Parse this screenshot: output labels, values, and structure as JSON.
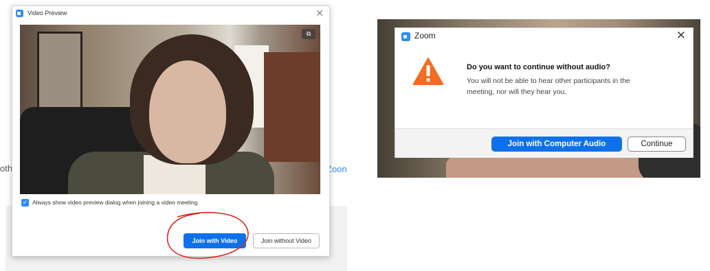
{
  "background": {
    "left_partial_text": "oth",
    "right_partial_text": "Zoon"
  },
  "video_preview": {
    "title": "Video Preview",
    "close_glyph": "✕",
    "camera_switch_glyph": "⧉",
    "always_show_checked": true,
    "always_show_label": "Always show video preview dialog when joining a video meeting",
    "join_with_video_label": "Join with Video",
    "join_without_video_label": "Join without Video",
    "annotation_color": "#e0231c"
  },
  "audio_dialog": {
    "title": "Zoom",
    "close_glyph": "✕",
    "warning_icon": "warning-triangle-icon",
    "warning_color": "#f26d21",
    "heading": "Do you want to continue without audio?",
    "body_line1": "You will not be able to hear other participants in the",
    "body_line2": "meeting, nor will they hear you.",
    "join_audio_label": "Join with Computer Audio",
    "continue_label": "Continue"
  },
  "colors": {
    "accent": "#0e71eb",
    "brand": "#2d8cff"
  }
}
